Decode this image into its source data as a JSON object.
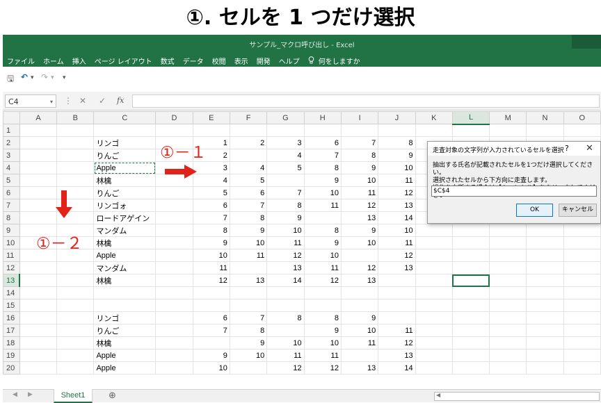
{
  "slide": {
    "title": "①. セルを 1 つだけ選択"
  },
  "window": {
    "title": "サンプル_マクロ呼び出し  -  Excel"
  },
  "ribbon": {
    "tabs": [
      "ファイル",
      "ホーム",
      "挿入",
      "ページ レイアウト",
      "数式",
      "データ",
      "校閲",
      "表示",
      "開発",
      "ヘルプ"
    ],
    "tell_me": "何をしますか"
  },
  "qat": {
    "save": "🖫",
    "undo": "↶",
    "undo_dd": "▾",
    "redo": "↷",
    "redo_dd": "▾",
    "customize": "▾"
  },
  "formula_bar": {
    "name_box": "C4",
    "dropdown": "▾",
    "separator": "⋮",
    "cancel": "✕",
    "enter": "✓",
    "fx": "fx",
    "value": ""
  },
  "grid": {
    "columns": [
      "A",
      "B",
      "C",
      "D",
      "E",
      "F",
      "G",
      "H",
      "I",
      "J",
      "K",
      "L",
      "M",
      "N",
      "O"
    ],
    "rows": [
      {
        "n": "1",
        "c": "",
        "e": "",
        "f": "",
        "g": "",
        "h": "",
        "i": "",
        "j": ""
      },
      {
        "n": "2",
        "c": "リンゴ",
        "e": "1",
        "f": "2",
        "g": "3",
        "h": "6",
        "i": "7",
        "j": "8"
      },
      {
        "n": "3",
        "c": "りんご",
        "e": "2",
        "f": "",
        "g": "4",
        "h": "7",
        "i": "8",
        "j": "9"
      },
      {
        "n": "4",
        "c": "Apple",
        "e": "3",
        "f": "4",
        "g": "5",
        "h": "8",
        "i": "9",
        "j": "10"
      },
      {
        "n": "5",
        "c": "林檎",
        "e": "4",
        "f": "5",
        "g": "",
        "h": "9",
        "i": "10",
        "j": "11"
      },
      {
        "n": "6",
        "c": "りんご",
        "e": "5",
        "f": "6",
        "g": "7",
        "h": "10",
        "i": "11",
        "j": "12"
      },
      {
        "n": "7",
        "c": "リンゴォ",
        "e": "6",
        "f": "7",
        "g": "8",
        "h": "11",
        "i": "12",
        "j": "13"
      },
      {
        "n": "8",
        "c": "ロードアゲイン",
        "e": "7",
        "f": "8",
        "g": "9",
        "h": "",
        "i": "13",
        "j": "14"
      },
      {
        "n": "9",
        "c": "マンダム",
        "e": "8",
        "f": "9",
        "g": "10",
        "h": "8",
        "i": "9",
        "j": "10"
      },
      {
        "n": "10",
        "c": "林檎",
        "e": "9",
        "f": "10",
        "g": "11",
        "h": "9",
        "i": "10",
        "j": "11"
      },
      {
        "n": "11",
        "c": "Apple",
        "e": "10",
        "f": "11",
        "g": "12",
        "h": "10",
        "i": "",
        "j": "12"
      },
      {
        "n": "12",
        "c": "マンダム",
        "e": "11",
        "f": "",
        "g": "13",
        "h": "11",
        "i": "12",
        "j": "13"
      },
      {
        "n": "13",
        "c": "林檎",
        "e": "12",
        "f": "13",
        "g": "14",
        "h": "12",
        "i": "13",
        "j": ""
      },
      {
        "n": "14",
        "c": "",
        "e": "",
        "f": "",
        "g": "",
        "h": "",
        "i": "",
        "j": ""
      },
      {
        "n": "15",
        "c": "",
        "e": "",
        "f": "",
        "g": "",
        "h": "",
        "i": "",
        "j": ""
      },
      {
        "n": "16",
        "c": "リンゴ",
        "e": "6",
        "f": "7",
        "g": "8",
        "h": "8",
        "i": "9",
        "j": ""
      },
      {
        "n": "17",
        "c": "りんご",
        "e": "7",
        "f": "8",
        "g": "",
        "h": "9",
        "i": "10",
        "j": "11"
      },
      {
        "n": "18",
        "c": "林檎",
        "e": "",
        "f": "9",
        "g": "10",
        "h": "10",
        "i": "11",
        "j": "12"
      },
      {
        "n": "19",
        "c": "Apple",
        "e": "9",
        "f": "10",
        "g": "11",
        "h": "11",
        "i": "",
        "j": "13"
      },
      {
        "n": "20",
        "c": "Apple",
        "e": "10",
        "f": "",
        "g": "12",
        "h": "12",
        "i": "13",
        "j": "14"
      }
    ]
  },
  "annotations": {
    "label_1_1": "①－１",
    "label_1_2": "①－２"
  },
  "dialog": {
    "title": "走査対象の文字列が入力されているセルを選択",
    "help": "?",
    "close": "✕",
    "message_1": "抽出する氏名が記載されたセルを1つだけ選択してください。",
    "message_2": "選択されたセルから下方向に走査します。",
    "message_3": "操作を中断する場合は【キャンセル】をクリックしてください",
    "input_value": "$C$4",
    "ok": "OK",
    "cancel": "キャンセル"
  },
  "sheet_tabs": {
    "active": "Sheet1",
    "add": "⊕",
    "prev": "◀",
    "next": "▶",
    "scroll_left": "◀"
  },
  "colors": {
    "excel_green": "#217346",
    "annotation_red": "#e2231a"
  }
}
